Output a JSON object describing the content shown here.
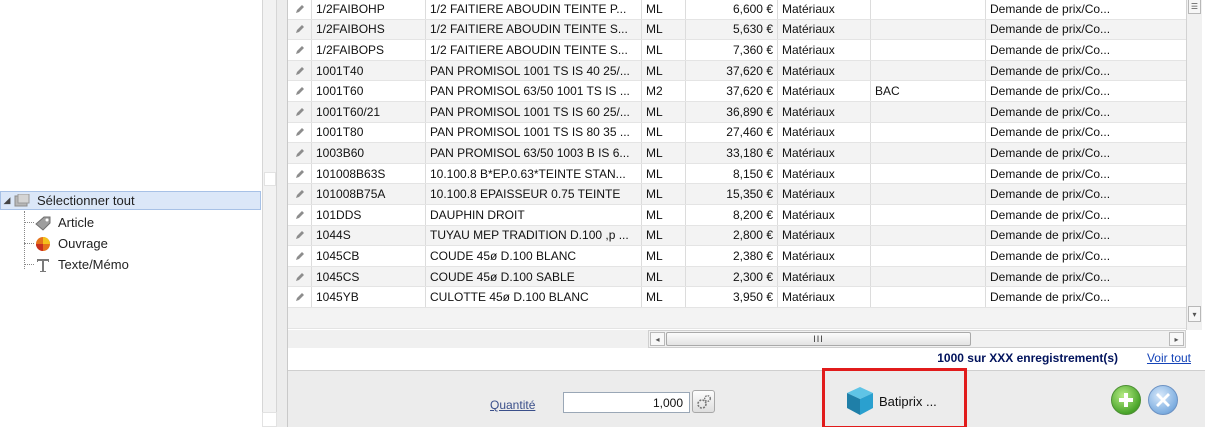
{
  "tree": {
    "items": [
      {
        "label": "Sélectionner tout",
        "icon": "select-all-icon",
        "selected": true
      },
      {
        "label": "Article",
        "icon": "article-icon"
      },
      {
        "label": "Ouvrage",
        "icon": "ouvrage-icon"
      },
      {
        "label": "Texte/Mémo",
        "icon": "text-memo-icon"
      }
    ]
  },
  "grid": {
    "rows": [
      {
        "code": "1/2FAIBOHP",
        "libelle": "1/2 FAITIERE ABOUDIN TEINTE P...",
        "unite": "ML",
        "prix": "6,600 €",
        "type": "Matériaux",
        "extra": "",
        "demande": "Demande de prix/Co..."
      },
      {
        "code": "1/2FAIBOHS",
        "libelle": "1/2 FAITIERE ABOUDIN TEINTE S...",
        "unite": "ML",
        "prix": "5,630 €",
        "type": "Matériaux",
        "extra": "",
        "demande": "Demande de prix/Co..."
      },
      {
        "code": "1/2FAIBOPS",
        "libelle": "1/2 FAITIERE ABOUDIN TEINTE S...",
        "unite": "ML",
        "prix": "7,360 €",
        "type": "Matériaux",
        "extra": "",
        "demande": "Demande de prix/Co..."
      },
      {
        "code": "1001T40",
        "libelle": "PAN PROMISOL 1001 TS IS 40 25/...",
        "unite": "ML",
        "prix": "37,620 €",
        "type": "Matériaux",
        "extra": "",
        "demande": "Demande de prix/Co..."
      },
      {
        "code": "1001T60",
        "libelle": "PAN PROMISOL 63/50 1001 TS IS ...",
        "unite": "M2",
        "prix": "37,620 €",
        "type": "Matériaux",
        "extra": "BAC",
        "demande": "Demande de prix/Co..."
      },
      {
        "code": "1001T60/21",
        "libelle": "PAN PROMISOL 1001 TS IS 60 25/...",
        "unite": "ML",
        "prix": "36,890 €",
        "type": "Matériaux",
        "extra": "",
        "demande": "Demande de prix/Co..."
      },
      {
        "code": "1001T80",
        "libelle": "PAN PROMISOL 1001 TS IS 80 35 ...",
        "unite": "ML",
        "prix": "27,460 €",
        "type": "Matériaux",
        "extra": "",
        "demande": "Demande de prix/Co..."
      },
      {
        "code": "1003B60",
        "libelle": "PAN PROMISOL 63/50 1003 B IS 6...",
        "unite": "ML",
        "prix": "33,180 €",
        "type": "Matériaux",
        "extra": "",
        "demande": "Demande de prix/Co..."
      },
      {
        "code": "101008B63S",
        "libelle": "10.100.8 B*EP.0.63*TEINTE STAN...",
        "unite": "ML",
        "prix": "8,150 €",
        "type": "Matériaux",
        "extra": "",
        "demande": "Demande de prix/Co..."
      },
      {
        "code": "101008B75A",
        "libelle": "10.100.8 EPAISSEUR 0.75 TEINTE",
        "unite": "ML",
        "prix": "15,350 €",
        "type": "Matériaux",
        "extra": "",
        "demande": "Demande de prix/Co..."
      },
      {
        "code": "101DDS",
        "libelle": "DAUPHIN DROIT",
        "unite": "ML",
        "prix": "8,200 €",
        "type": "Matériaux",
        "extra": "",
        "demande": "Demande de prix/Co..."
      },
      {
        "code": "1044S",
        "libelle": "TUYAU MEP TRADITION D.100 ,p ...",
        "unite": "ML",
        "prix": "2,800 €",
        "type": "Matériaux",
        "extra": "",
        "demande": "Demande de prix/Co..."
      },
      {
        "code": "1045CB",
        "libelle": "COUDE 45ø D.100 BLANC",
        "unite": "ML",
        "prix": "2,380 €",
        "type": "Matériaux",
        "extra": "",
        "demande": "Demande de prix/Co..."
      },
      {
        "code": "1045CS",
        "libelle": "COUDE 45ø D.100 SABLE",
        "unite": "ML",
        "prix": "2,300 €",
        "type": "Matériaux",
        "extra": "",
        "demande": "Demande de prix/Co..."
      },
      {
        "code": "1045YB",
        "libelle": "CULOTTE 45ø D.100 BLANC",
        "unite": "ML",
        "prix": "3,950 €",
        "type": "Matériaux",
        "extra": "",
        "demande": "Demande de prix/Co..."
      }
    ]
  },
  "hscroll": {
    "thumb_grip": "III"
  },
  "footer": {
    "count_text": "1000 sur XXX enregistrement(s)",
    "voir_tout": "Voir tout"
  },
  "bottom": {
    "quantite_label": "Quantité",
    "quantite_value": "1,000",
    "batiprix_label": "Batiprix ...",
    "highlight_color": "#e11b1b"
  }
}
